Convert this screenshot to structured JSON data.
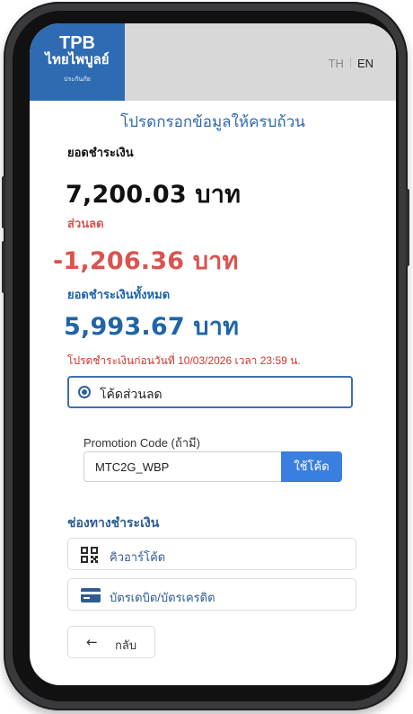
{
  "header": {
    "logo": {
      "name_en": "TPB",
      "name_th": "ไทยไพบูลย์",
      "tagline": "ประกันภัย"
    },
    "language": {
      "th": "TH",
      "en": "EN",
      "selected": "EN"
    }
  },
  "instruction": "โปรดกรอกข้อมูลให้ครบถ้วน",
  "payment": {
    "amount_label": "ยอดชำระเงิน",
    "amount_value": "7,200.03 บาท",
    "discount_label": "ส่วนลด",
    "discount_value": "-1,206.36 บาท",
    "total_label": "ยอดชำระเงินทั้งหมด",
    "total_value": "5,993.67 บาท",
    "deadline": "โปรดชำระเงินก่อนวันที่ 10/03/2026 เวลา 23:59 น."
  },
  "discount_option": {
    "label": "โค้ดส่วนลด",
    "selected": true
  },
  "promo": {
    "label": "Promotion Code (ถ้ามี)",
    "value": "MTC2G_WBP",
    "apply_button": "ใช้โค้ด"
  },
  "channels": {
    "title": "ช่องทางชำระเงิน",
    "items": [
      {
        "label": "คิวอาร์โค้ด",
        "icon": "qr-code-icon"
      },
      {
        "label": "บัตรเดบิต/บัตรเครดิต",
        "icon": "credit-card-icon"
      }
    ]
  },
  "back_button": "กลับ",
  "colors": {
    "brand_blue": "#2f6bb3",
    "amount_black": "#111111",
    "discount_red": "#d9534f",
    "total_blue": "#1f64a8",
    "apply_button": "#3a7fe0"
  }
}
